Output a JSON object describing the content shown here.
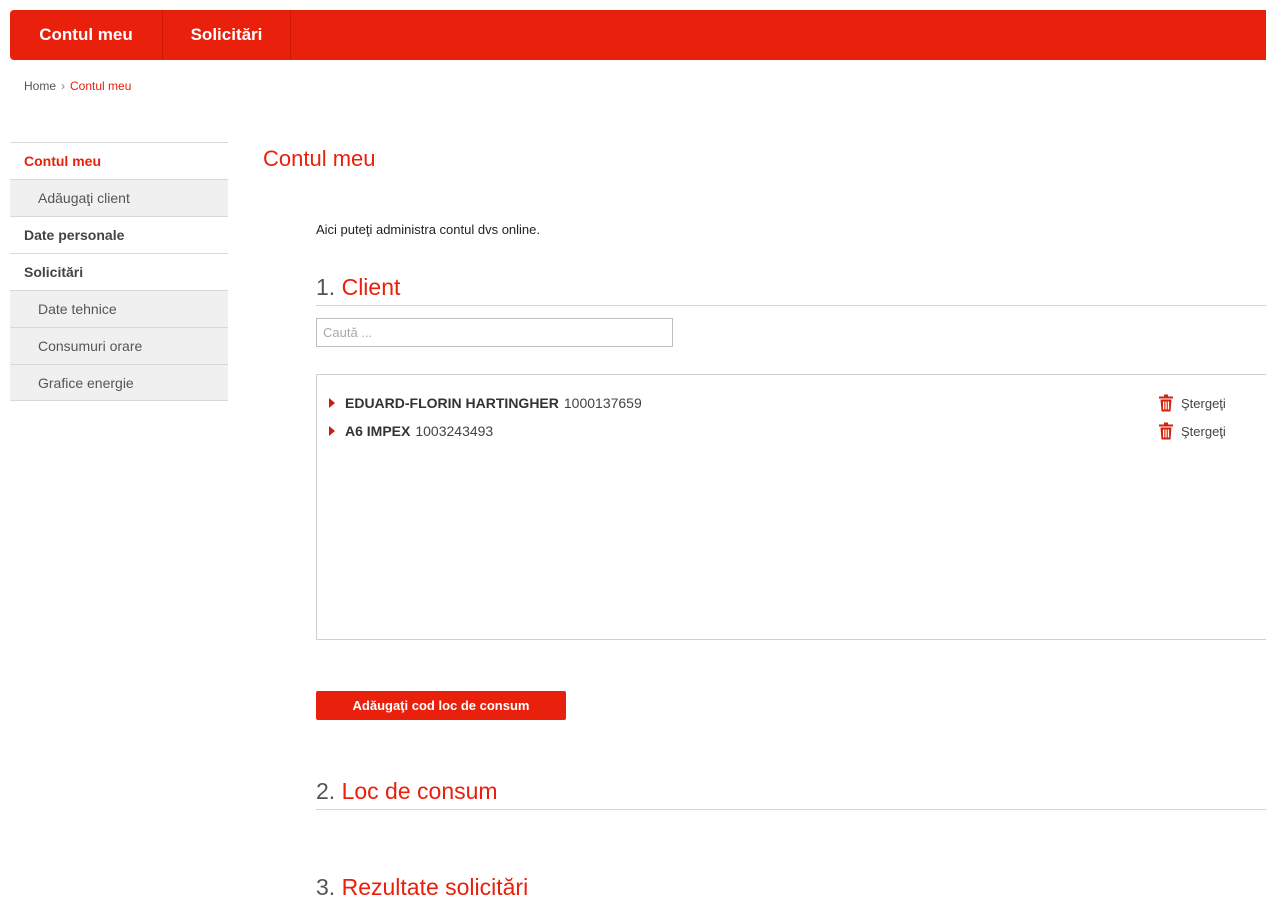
{
  "nav": {
    "tabs": [
      {
        "label": "Contul meu"
      },
      {
        "label": "Solicitări"
      }
    ]
  },
  "breadcrumb": {
    "home": "Home",
    "separator": "›",
    "current": "Contul meu"
  },
  "sidebar": {
    "items": [
      {
        "label": "Contul meu"
      },
      {
        "label": "Adăugaţi client"
      },
      {
        "label": "Date personale"
      },
      {
        "label": "Solicitări"
      },
      {
        "label": "Date tehnice"
      },
      {
        "label": "Consumuri orare"
      },
      {
        "label": "Grafice energie"
      }
    ]
  },
  "main": {
    "title": "Contul meu",
    "intro": "Aici puteţi administra contul dvs online.",
    "sections": [
      {
        "number": "1.",
        "name": "Client"
      },
      {
        "number": "2.",
        "name": "Loc de consum"
      },
      {
        "number": "3.",
        "name": "Rezultate solicitări"
      }
    ],
    "search": {
      "placeholder": "Caută ...",
      "value": ""
    },
    "clients": [
      {
        "name": "EDUARD-FLORIN HARTINGHER",
        "code": "1000137659",
        "delete_label": "Ştergeţi"
      },
      {
        "name": "A6 IMPEX",
        "code": "1003243493",
        "delete_label": "Ştergeţi"
      }
    ],
    "add_button_label": "Adăugaţi cod loc de consum"
  },
  "colors": {
    "brand_red": "#e8200c",
    "sidebar_sub_bg": "#f0f0f0"
  }
}
